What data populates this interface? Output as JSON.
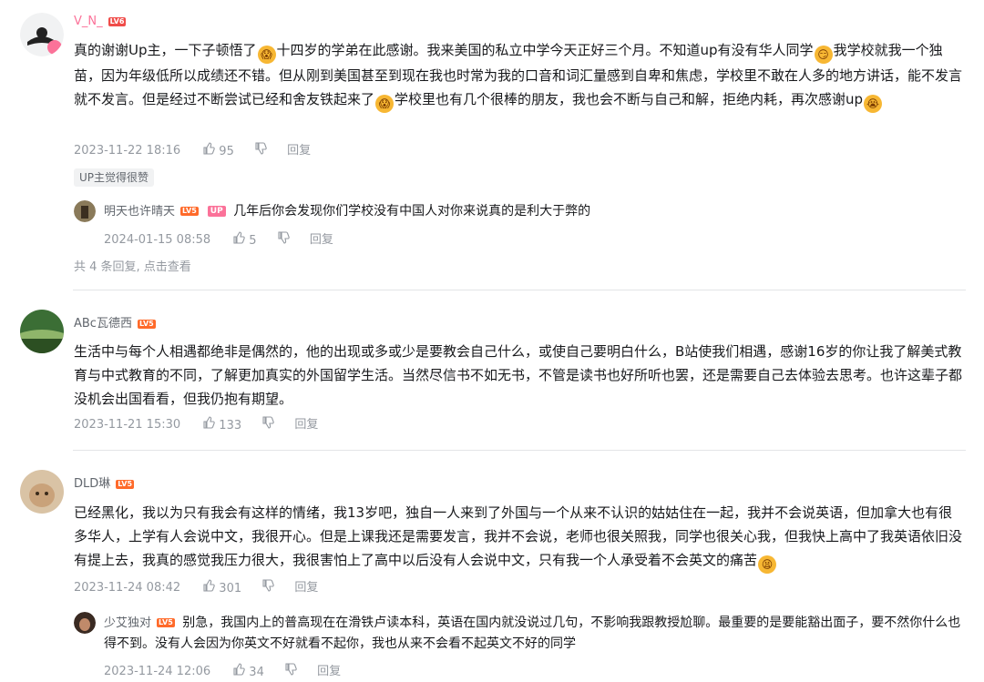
{
  "comments": [
    {
      "user": "V_N_",
      "level": "LV6",
      "text_parts": [
        "真的谢谢Up主，一下子顿悟了",
        "十四岁的学弟在此感谢。我来美国的私立中学今天正好三个月。不知道up有没有华人同学",
        "我学校就我一个独苗，因为年级低所以成绩还不错。但从刚到美国甚至到现在我也时常为我的口音和词汇量感到自卑和焦虑，学校里不敢在人多的地方讲话，能不发言就不发言。但是经过不断尝试已经和舍友铁起来了",
        "学校里也有几个很棒的朋友，我也会不断与自己和解，拒绝内耗，再次感谢up"
      ],
      "date": "2023-11-22 18:16",
      "likes": "95",
      "reply_label": "回复",
      "tag": "UP主觉得很赞",
      "replies": [
        {
          "user": "明天也许晴天",
          "level": "LV5",
          "badge": "UP",
          "text": "几年后你会发现你们学校没有中国人对你来说真的是利大于弊的",
          "date": "2024-01-15 08:58",
          "likes": "5",
          "reply_label": "回复"
        }
      ],
      "more": "共 4 条回复, 点击查看"
    },
    {
      "user": "ABc瓦德西",
      "level": "LV5",
      "text": "生活中与每个人相遇都绝非是偶然的，他的出现或多或少是要教会自己什么，或使自己要明白什么，B站使我们相遇，感谢16岁的你让我了解美式教育与中式教育的不同，了解更加真实的外国留学生活。当然尽信书不如无书，不管是读书也好所听也罢，还是需要自己去体验去思考。也许这辈子都没机会出国看看，但我仍抱有期望。",
      "date": "2023-11-21 15:30",
      "likes": "133",
      "reply_label": "回复"
    },
    {
      "user": "DLD琳",
      "level": "LV5",
      "text": "已经黑化，我以为只有我会有这样的情绪，我13岁吧，独自一人来到了外国与一个从来不认识的姑姑住在一起，我并不会说英语，但加拿大也有很多华人，上学有人会说中文，我很开心。但是上课我还是需要发言，我并不会说，老师也很关照我，同学也很关心我，但我快上高中了我英语依旧没有提上去，我真的感觉我压力很大，我很害怕上了高中以后没有人会说中文，只有我一个人承受着不会英文的痛苦",
      "date": "2023-11-24 08:42",
      "likes": "301",
      "reply_label": "回复",
      "replies": [
        {
          "user": "少艾独对",
          "level": "LV5",
          "text": "别急，我国内上的普高现在在滑铁卢读本科，英语在国内就没说过几句，不影响我跟教授尬聊。最重要的是要能豁出面子，要不然你什么也得不到。没有人会因为你英文不好就看不起你，我也从来不会看不起英文不好的同学",
          "date": "2023-11-24 12:06",
          "likes": "34",
          "reply_label": "回复"
        }
      ]
    }
  ],
  "colors": {
    "text": "#18191c",
    "meta": "#9499a0",
    "level": "#ff6a2a",
    "up_badge": "#fb7299"
  }
}
